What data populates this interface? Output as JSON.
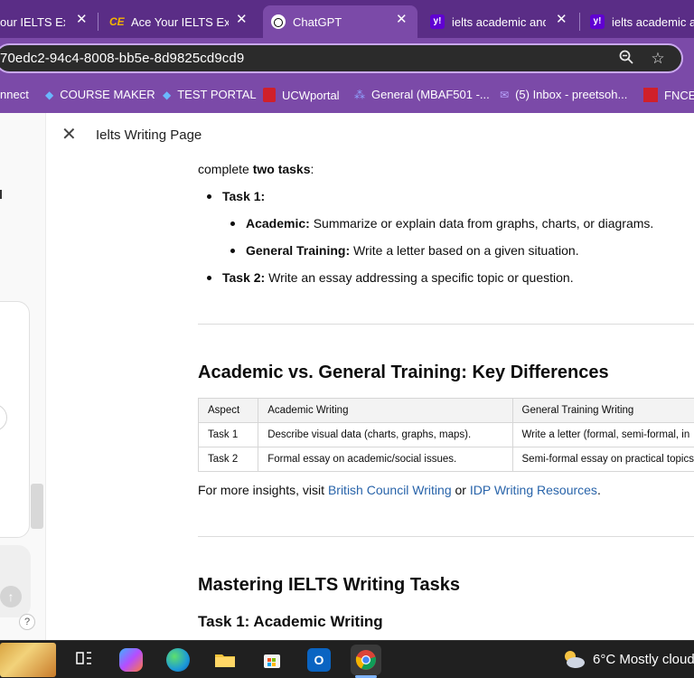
{
  "browser": {
    "tabs": [
      {
        "title": "our IELTS Exa",
        "favicon": "yahoo-icon",
        "active": false
      },
      {
        "title": "Ace Your IELTS Exa",
        "favicon": "ce-icon",
        "active": false
      },
      {
        "title": "ChatGPT",
        "favicon": "chatgpt-icon",
        "active": true
      },
      {
        "title": "ielts academic and",
        "favicon": "yahoo-icon",
        "active": false
      },
      {
        "title": "ielts academic an",
        "favicon": "yahoo-icon",
        "active": false
      }
    ],
    "close_glyph": "✕",
    "url": "70edc2-94c4-8008-bb5e-8d9825cd9cd9",
    "bookmarks": [
      {
        "label": "nnect"
      },
      {
        "label": "COURSE MAKER"
      },
      {
        "label": "TEST PORTAL"
      },
      {
        "label": "UCWportal"
      },
      {
        "label": "General (MBAF501 -..."
      },
      {
        "label": "(5) Inbox - preetsoh..."
      },
      {
        "label": "FNCE"
      }
    ]
  },
  "sidepanel": {
    "help_label": "?"
  },
  "canvas": {
    "title": "Ielts Writing Page",
    "intro": {
      "text": "complete ",
      "bold": "two tasks",
      "suffix": ":"
    },
    "tasks": {
      "task1_label": "Task 1:",
      "academic_label": "Academic:",
      "academic_text": " Summarize or explain data from graphs, charts, or diagrams.",
      "general_label": "General Training:",
      "general_text": " Write a letter based on a given situation.",
      "task2_label": "Task 2:",
      "task2_text": " Write an essay addressing a specific topic or question."
    },
    "section1_heading": "Academic vs. General Training: Key Differences",
    "table": {
      "headers": [
        "Aspect",
        "Academic Writing",
        "General Training Writing"
      ],
      "rows": [
        [
          "Task 1",
          "Describe visual data (charts, graphs, maps).",
          "Write a letter (formal, semi-formal, in"
        ],
        [
          "Task 2",
          "Formal essay on academic/social issues.",
          "Semi-formal essay on practical topics"
        ]
      ]
    },
    "insights": {
      "prefix": "For more insights, visit ",
      "link1": "British Council Writing",
      "middle": " or ",
      "link2": "IDP Writing Resources",
      "suffix": "."
    },
    "section2_heading": "Mastering IELTS Writing Tasks",
    "section2_sub": "Task 1: Academic Writing"
  },
  "taskbar": {
    "weather": "6°C  Mostly cloud"
  },
  "colors": {
    "browser_frame": "#7b4aa8",
    "tab_strip": "#5a2d86",
    "link": "#2964aa",
    "taskbar": "#202020"
  }
}
